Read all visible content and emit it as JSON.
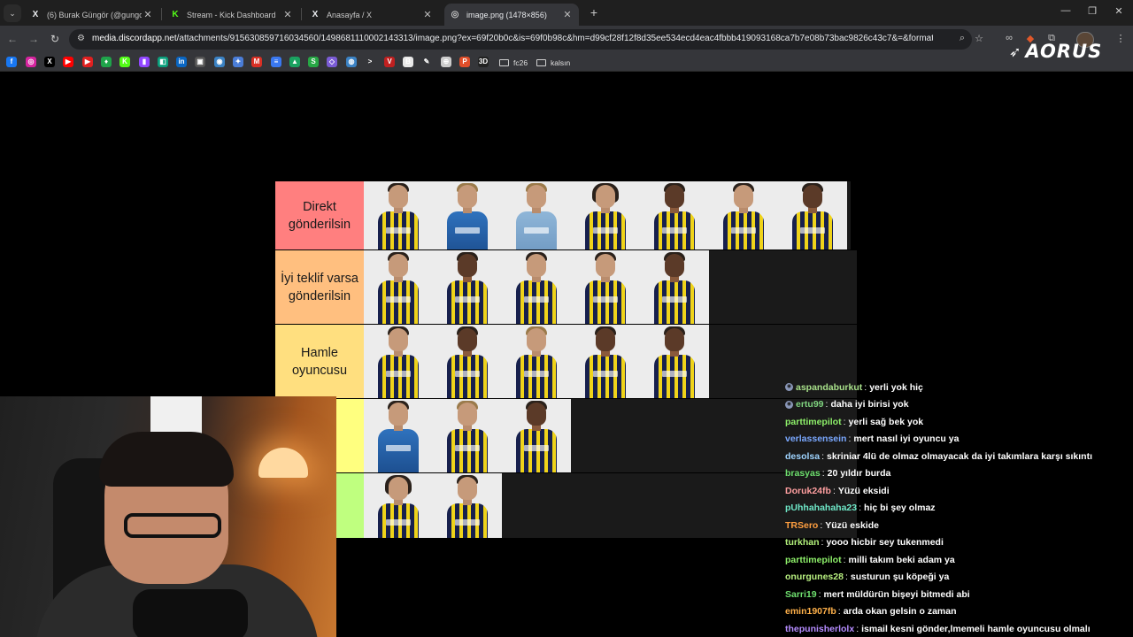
{
  "browser": {
    "tabs": [
      {
        "title": "(6) Burak Güngör (@gungorbur",
        "icon": "x-logo-icon",
        "active": false
      },
      {
        "title": "Stream - Kick Dashboard",
        "icon": "kick-logo-icon",
        "active": false
      },
      {
        "title": "Anasayfa / X",
        "icon": "x-logo-icon",
        "active": false
      },
      {
        "title": "image.png (1478×856)",
        "icon": "globe-icon",
        "active": true
      }
    ],
    "url_host": "media.discordapp.net",
    "url_rest": "/attachments/915630859716034560/1498681110002143313/image.png?ex=69f20b0c&is=69f0b98c&hm=d99cf28f12f8d35ee534ecd4eac4fbbb419093168ca7b7e08b73bac9826c43c7&=&format=webp&quality=l...",
    "bookmark_folders": [
      "fc26",
      "kalsın"
    ],
    "bookmark_icons": [
      {
        "name": "facebook-icon",
        "color": "#1877f2",
        "glyph": "f"
      },
      {
        "name": "instagram-icon",
        "color": "#d6249f",
        "glyph": "◎"
      },
      {
        "name": "x-logo-icon",
        "color": "#000000",
        "glyph": "X"
      },
      {
        "name": "youtube-icon",
        "color": "#ff0000",
        "glyph": "▶"
      },
      {
        "name": "youtube-icon",
        "color": "#e02020",
        "glyph": "▶"
      },
      {
        "name": "leaf-icon",
        "color": "#1fa34a",
        "glyph": "♦"
      },
      {
        "name": "kick-logo-icon",
        "color": "#53fc18",
        "glyph": "K"
      },
      {
        "name": "twitch-icon",
        "color": "#9146ff",
        "glyph": "▮"
      },
      {
        "name": "app-icon",
        "color": "#0a9f7c",
        "glyph": "◧"
      },
      {
        "name": "linkedin-icon",
        "color": "#0a66c2",
        "glyph": "in"
      },
      {
        "name": "app-icon",
        "color": "#555555",
        "glyph": "▣"
      },
      {
        "name": "app-icon",
        "color": "#3b82c4",
        "glyph": "◉"
      },
      {
        "name": "sparkle-icon",
        "color": "#4a7dd8",
        "glyph": "✦"
      },
      {
        "name": "gmail-icon",
        "color": "#d93025",
        "glyph": "M"
      },
      {
        "name": "docs-icon",
        "color": "#3a78f0",
        "glyph": "≡"
      },
      {
        "name": "drive-icon",
        "color": "#1aa260",
        "glyph": "▲"
      },
      {
        "name": "sheets-icon",
        "color": "#27a745",
        "glyph": "S"
      },
      {
        "name": "app-icon",
        "color": "#7b5cd6",
        "glyph": "◇"
      },
      {
        "name": "app-icon",
        "color": "#3b82c4",
        "glyph": "◍"
      },
      {
        "name": "chevron-right-icon",
        "color": "#35363a",
        "glyph": ">"
      },
      {
        "name": "app-icon",
        "color": "#c02020",
        "glyph": "V"
      },
      {
        "name": "app-icon",
        "color": "#e8e8e8",
        "glyph": "B"
      },
      {
        "name": "pen-icon",
        "color": "#35363a",
        "glyph": "✎"
      },
      {
        "name": "app-icon",
        "color": "#cccccc",
        "glyph": "⊕"
      },
      {
        "name": "app-icon",
        "color": "#e04e2a",
        "glyph": "P"
      },
      {
        "name": "app-icon",
        "color": "#222222",
        "glyph": "3D"
      }
    ],
    "brand_text": "AORUS"
  },
  "tierlist": {
    "tiers": [
      {
        "label": "Direkt gönderilsin",
        "color": "#ff7f7f",
        "players": 7
      },
      {
        "label": "İyi teklif varsa gönderilsin",
        "color": "#ffbf7f",
        "players": 5
      },
      {
        "label": "Hamle oyuncusu",
        "color": "#ffdf7f",
        "players": 5
      },
      {
        "label": "u",
        "color": "#ffff7f",
        "players": 3
      },
      {
        "label": "ar",
        "color": "#bfff7f",
        "players": 2
      }
    ]
  },
  "chat": {
    "truncated_top": "",
    "messages": [
      {
        "user": "aspandaburkut",
        "color": "#a8e08a",
        "badge": true,
        "text": "yerli yok hiç"
      },
      {
        "user": "ertu99",
        "color": "#7fd37f",
        "badge": true,
        "text": "daha iyi birisi yok"
      },
      {
        "user": "parttimepilot",
        "color": "#8ef06a",
        "badge": false,
        "text": "yerli sağ bek yok"
      },
      {
        "user": "verlassensein",
        "color": "#7aa8ff",
        "badge": false,
        "text": "mert nasıl iyi oyuncu ya"
      },
      {
        "user": "desolsa",
        "color": "#9fd4ff",
        "badge": false,
        "text": "skriniar 4lü de olmaz olmayacak da iyi takımlara karşı sıkıntı"
      },
      {
        "user": "brasyas",
        "color": "#6fe06f",
        "badge": false,
        "text": "20 yıldır burda"
      },
      {
        "user": "Doruk24fb",
        "color": "#ff9fa0",
        "badge": false,
        "text": "Yüzü eksidi"
      },
      {
        "user": "pUhhahahaha23",
        "color": "#6fe8c8",
        "badge": false,
        "text": "hiç bi şey olmaz"
      },
      {
        "user": "TRSero",
        "color": "#ff9f40",
        "badge": false,
        "text": "Yüzü eskide"
      },
      {
        "user": "turkhan",
        "color": "#b2f07a",
        "badge": false,
        "text": "yooo hicbir sey tukenmedi"
      },
      {
        "user": "parttimepilot",
        "color": "#8ef06a",
        "badge": false,
        "text": "milli takım beki adam ya"
      },
      {
        "user": "onurgunes28",
        "color": "#b8f080",
        "badge": false,
        "text": "susturun şu köpeği ya"
      },
      {
        "user": "Sarri19",
        "color": "#6fe06f",
        "badge": false,
        "text": "mert müldürün bişeyi bitmedi abi"
      },
      {
        "user": "emin1907fb",
        "color": "#ffb14a",
        "badge": false,
        "text": "arda okan gelsin o zaman"
      },
      {
        "user": "thepunisherlolx",
        "color": "#b58cff",
        "badge": false,
        "text": "ismail kesni gönder,lmemeli hamle oyuncusu olmalı"
      }
    ]
  }
}
